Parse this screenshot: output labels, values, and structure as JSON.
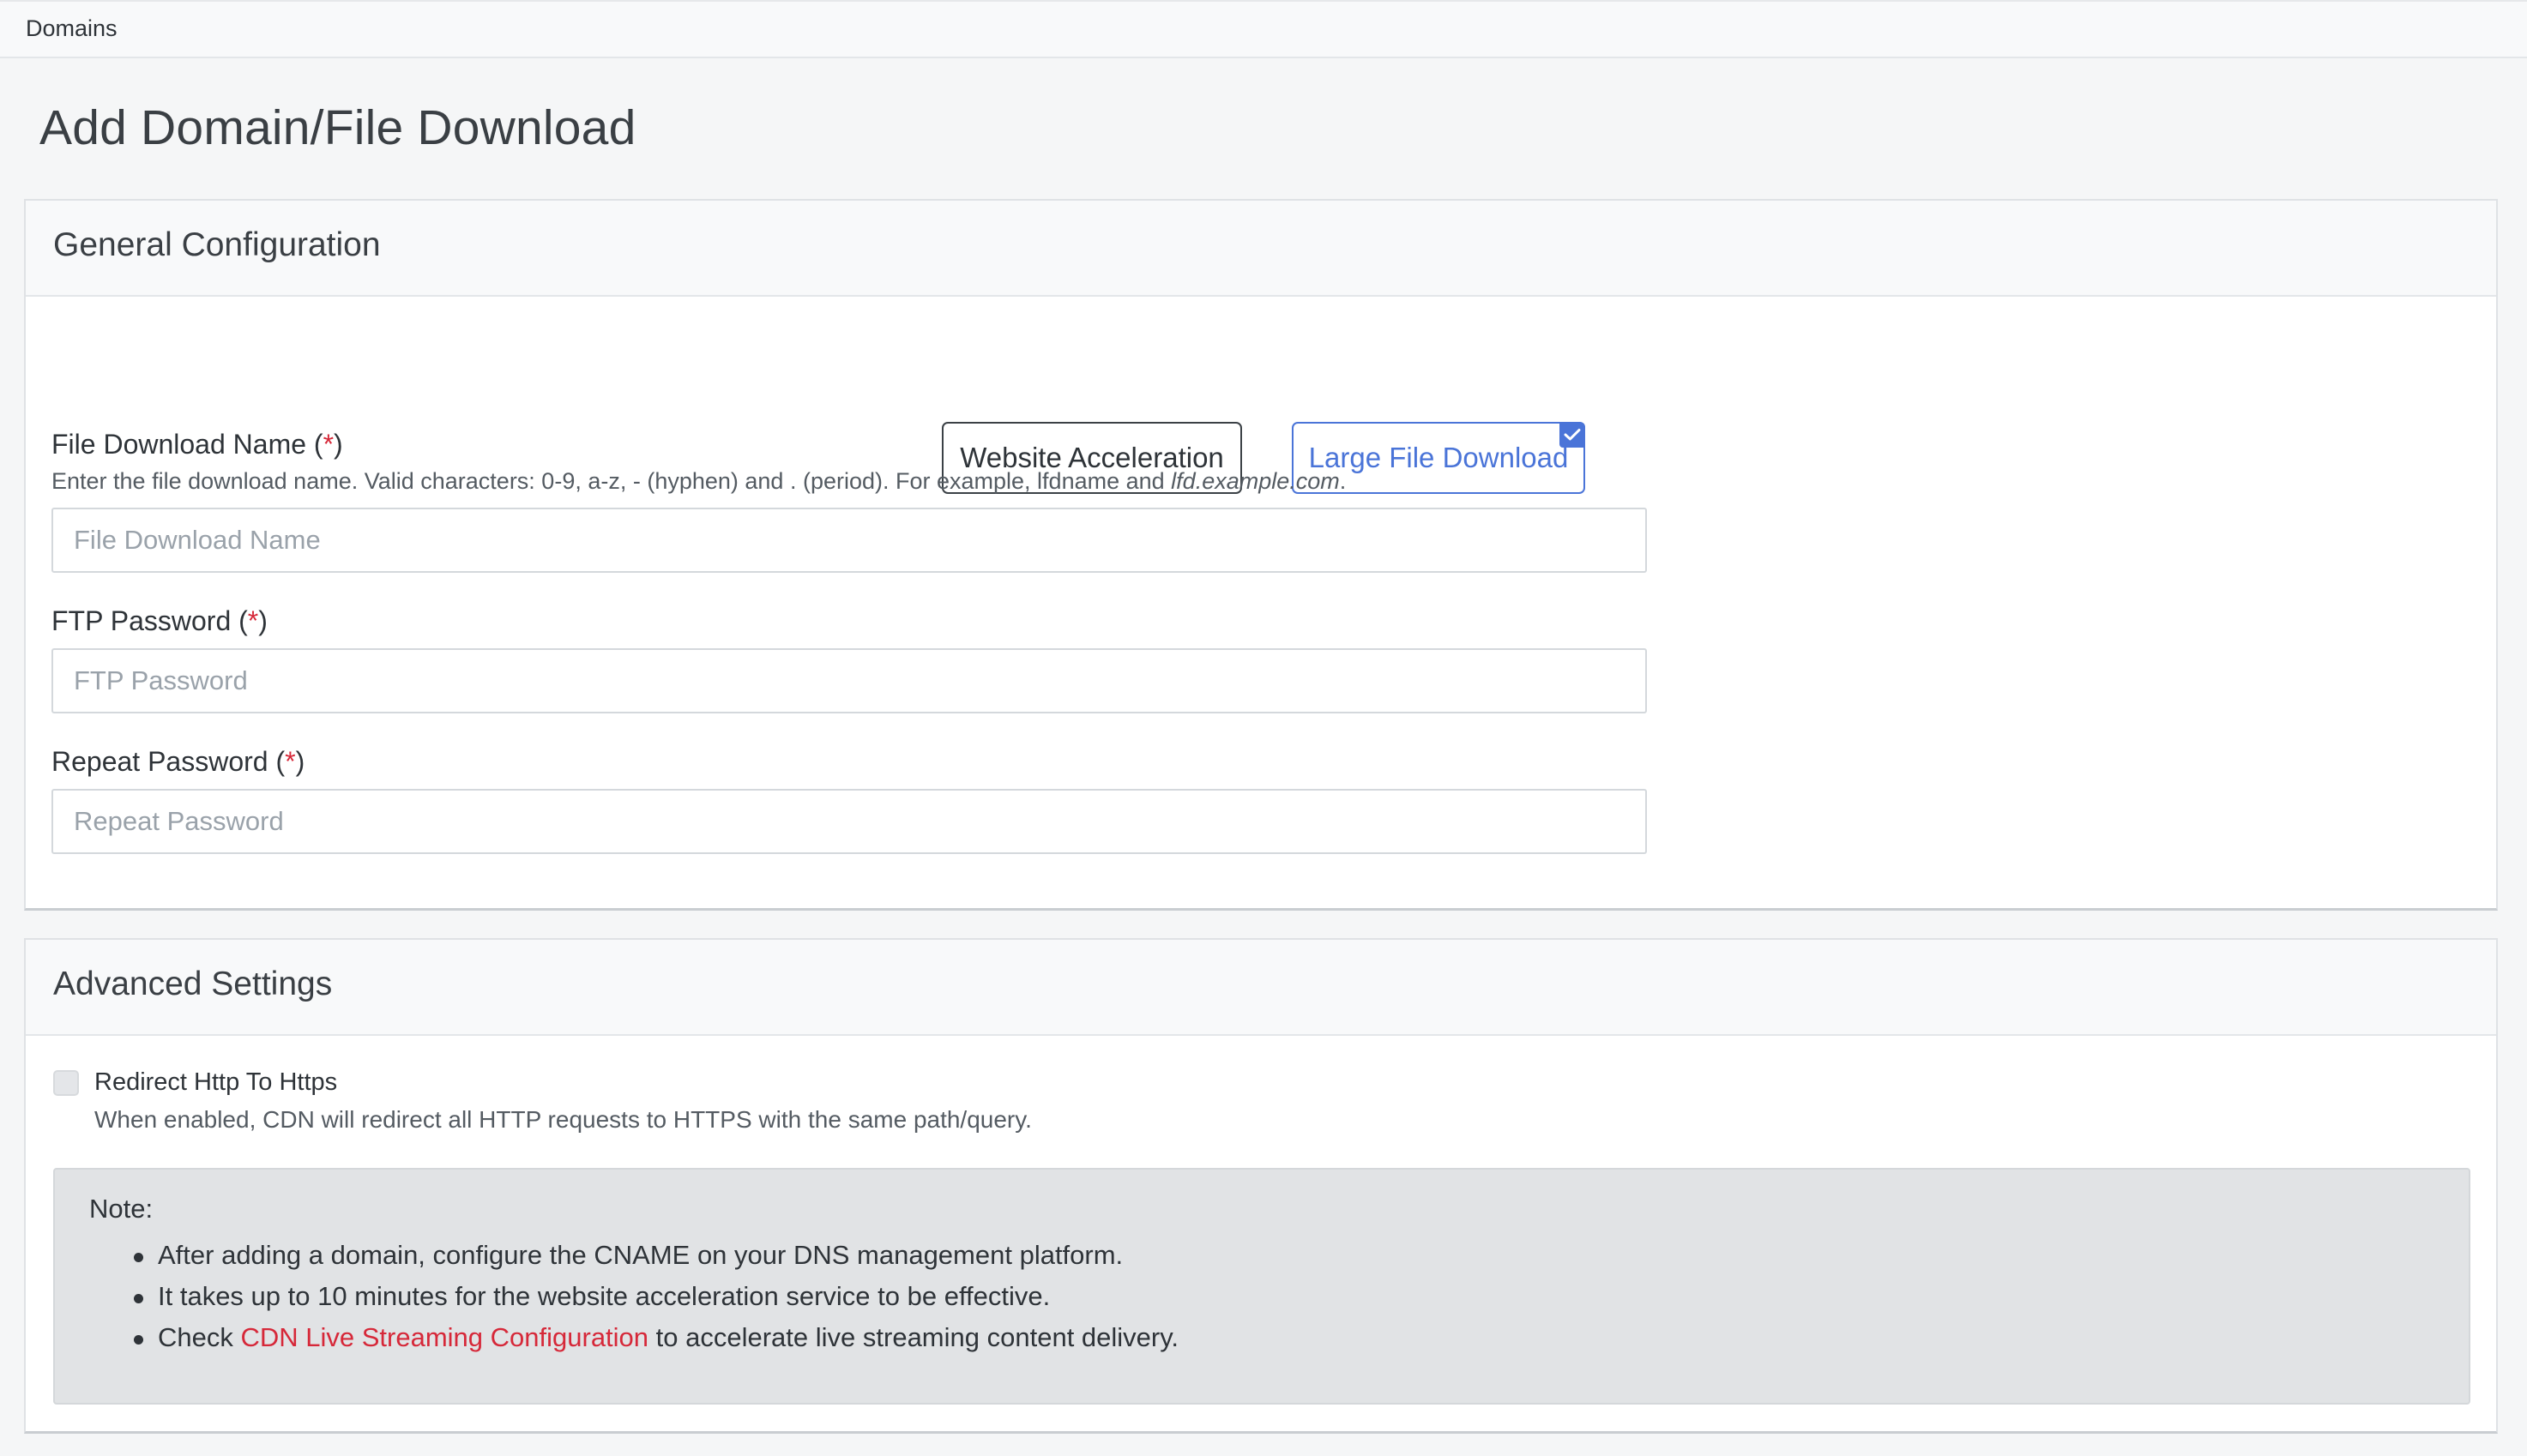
{
  "breadcrumb": "Domains",
  "page_title": "Add Domain/File Download",
  "general": {
    "title": "General Configuration",
    "type_options": {
      "website": "Website Acceleration",
      "large_file": "Large File Download",
      "selected": "Large File Download"
    },
    "file_download_name": {
      "label": "File Download Name (",
      "required_mark": "*",
      "label_close": ")",
      "help_prefix": "Enter the file download name. Valid characters: 0-9, a-z, - (hyphen) and . (period). For example, lfdname and ",
      "help_example": "lfd.example.com",
      "help_suffix": ".",
      "placeholder": "File Download Name",
      "value": ""
    },
    "ftp_password": {
      "label": "FTP Password (",
      "required_mark": "*",
      "label_close": ")",
      "placeholder": "FTP Password",
      "value": ""
    },
    "repeat_password": {
      "label": "Repeat Password (",
      "required_mark": "*",
      "label_close": ")",
      "placeholder": "Repeat Password",
      "value": ""
    }
  },
  "advanced": {
    "title": "Advanced Settings",
    "redirect": {
      "label": "Redirect Http To Https",
      "help": "When enabled, CDN will redirect all HTTP requests to HTTPS with the same path/query.",
      "checked": false
    },
    "note": {
      "title": "Note:",
      "items": [
        {
          "text": "After adding a domain, configure the CNAME on your DNS management platform."
        },
        {
          "text": "It takes up to 10 minutes for the website acceleration service to be effective."
        },
        {
          "prefix": "Check ",
          "link": "CDN Live Streaming Configuration",
          "suffix": " to accelerate live streaming content delivery."
        }
      ]
    }
  },
  "colors": {
    "accent": "#4a74d8",
    "required": "#d62839",
    "link": "#d62839"
  },
  "icons": {
    "selected_badge": "checkmark-icon"
  }
}
